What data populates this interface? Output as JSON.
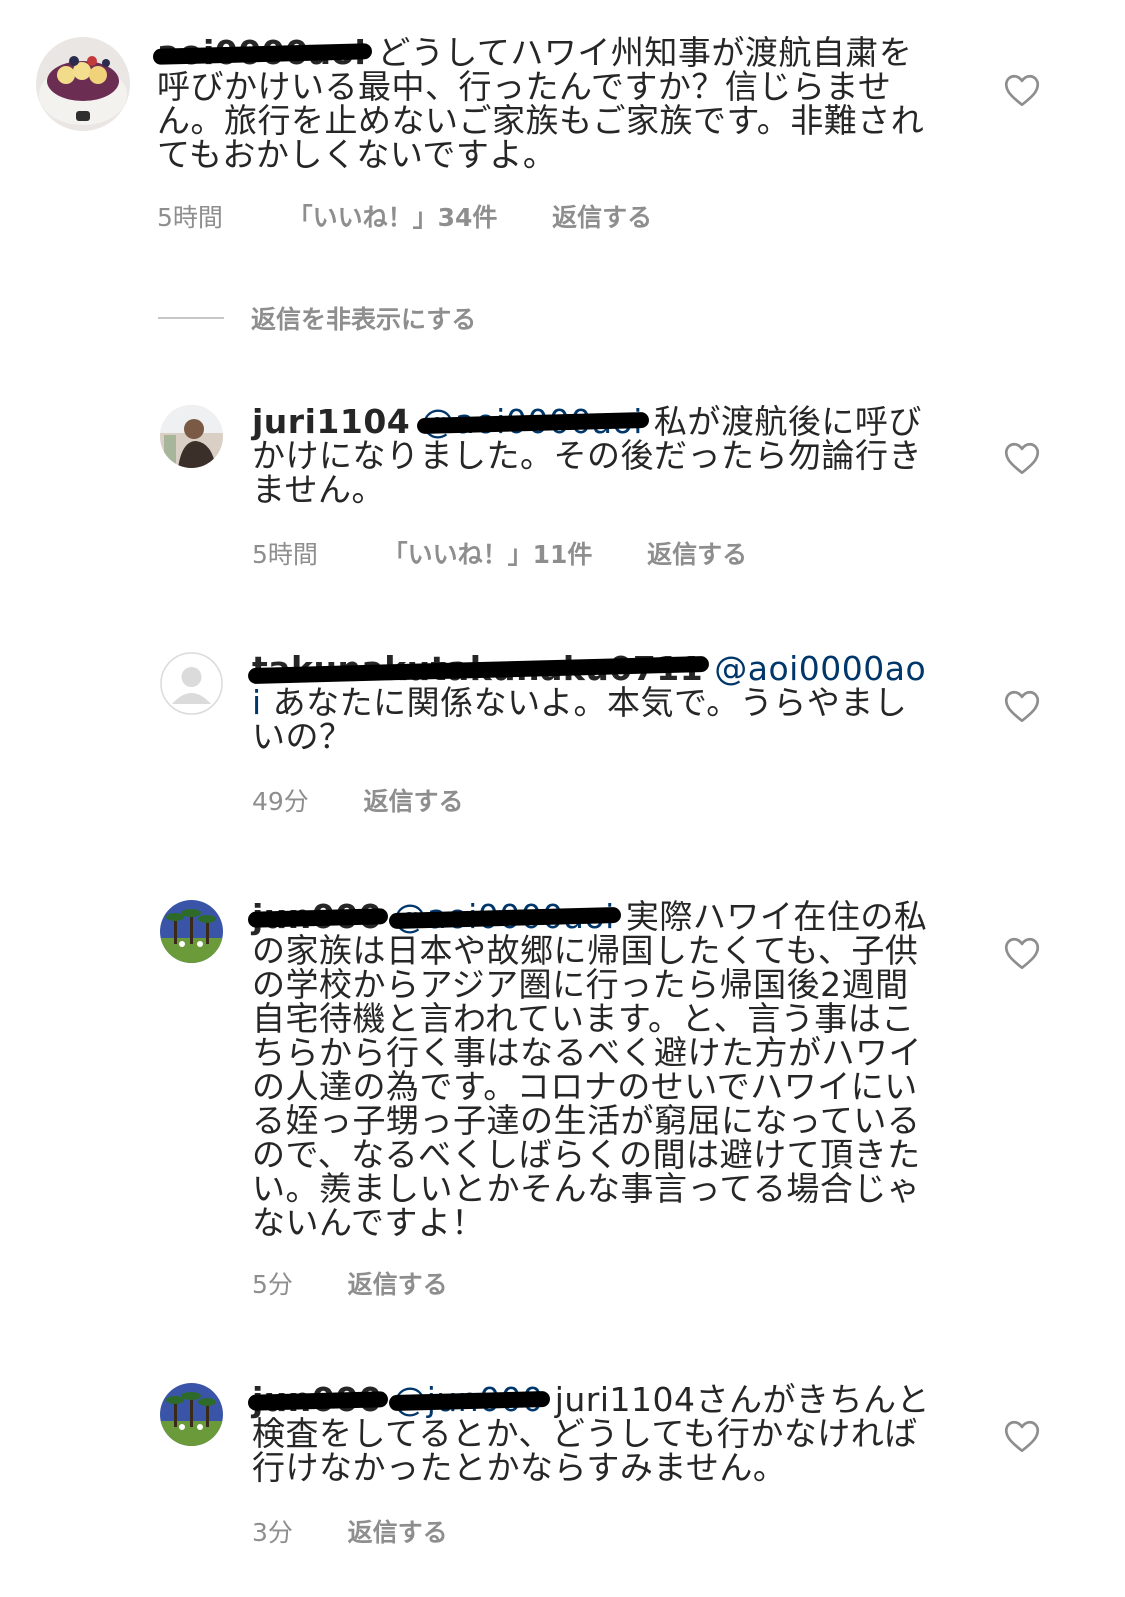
{
  "comments": [
    {
      "username": "aoi0000aoi",
      "text": "どうしてハワイ州知事が渡航自粛を呼びかけいる最中、行ったんですか？信じらません。旅行を止めないご家族もご家族です。非難されてもおかしくないですよ。",
      "time": "5時間",
      "likes": "「いいね！」34件",
      "reply": "返信する",
      "avatar": "acai-bowl-avatar"
    },
    {
      "username": "juri1104",
      "mention": "@aoi0000aoi",
      "text": "私が渡航後に呼びかけになりました。その後だったら勿論行きません。",
      "time": "5時間",
      "likes": "「いいね！」11件",
      "reply": "返信する",
      "avatar": "profile-photo-avatar"
    },
    {
      "username": "takunakutakunaku0711",
      "mention": "@aoi0000aoi",
      "text": "あなたに関係ないよ。本気で。うらやましいの？",
      "time": "49分",
      "reply": "返信する",
      "avatar": "default-avatar"
    },
    {
      "username": "jun000",
      "mention": "@aoi0000aoi",
      "text": "実際ハワイ在住の私の家族は日本や故郷に帰国したくても、子供の学校からアジア圏に行ったら帰国後2週間自宅待機と言われています。と、言う事はこちらから行く事はなるべく避けた方がハワイの人達の為です。コロナのせいでハワイにいる姪っ子甥っ子達の生活が窮屈になっているので、なるべくしばらくの間は避けて頂きたい。羨ましいとかそんな事言ってる場合じゃないんですよ！",
      "time": "5分",
      "reply": "返信する",
      "avatar": "palm-trees-avatar"
    },
    {
      "username": "jun000",
      "mention": "@jun000",
      "text": "juri1104さんがきちんと検査をしてるとか、どうしても行かなければ行けなかったとかならすみません。",
      "time": "3分",
      "reply": "返信する",
      "avatar": "palm-trees-avatar"
    }
  ],
  "hide_replies_label": "返信を非表示にする",
  "colors": {
    "text": "#262626",
    "meta": "#8e8e8e",
    "mention": "#00376b",
    "heart": "#8e8e8e"
  }
}
